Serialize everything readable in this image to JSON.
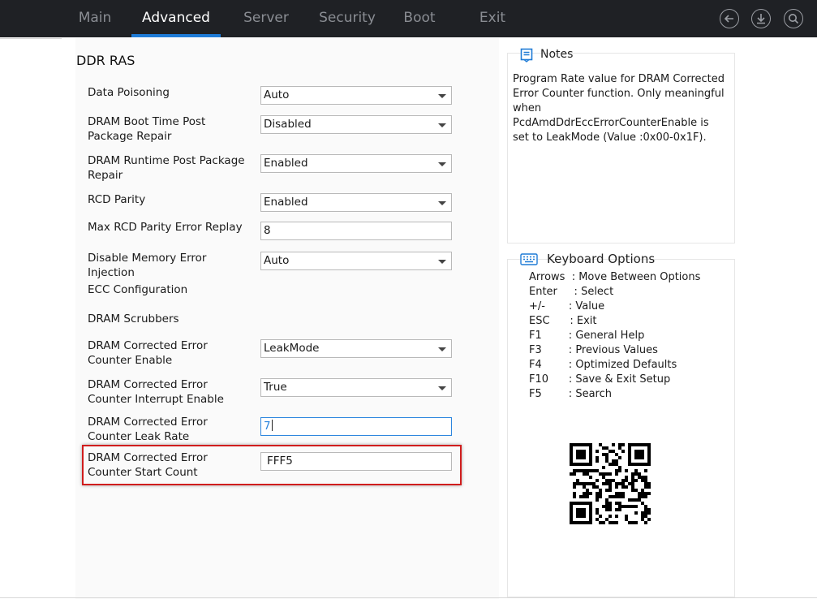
{
  "nav": {
    "tabs": [
      {
        "label": "Main"
      },
      {
        "label": "Advanced"
      },
      {
        "label": "Server"
      },
      {
        "label": "Security"
      },
      {
        "label": "Boot"
      },
      {
        "label": "Exit"
      }
    ],
    "active_tab": "Advanced",
    "icons": [
      "back-icon",
      "download-icon",
      "search-icon"
    ],
    "accent_color": "#1e7bd6"
  },
  "section": {
    "title": "DDR RAS"
  },
  "settings": [
    {
      "label": "Data Poisoning",
      "value": "Auto",
      "type": "dropdown"
    },
    {
      "label": "DRAM Boot Time Post Package Repair",
      "value": "Disabled",
      "type": "dropdown"
    },
    {
      "label": "DRAM Runtime Post Package Repair",
      "value": "Enabled",
      "type": "dropdown"
    },
    {
      "label": "RCD Parity",
      "value": "Enabled",
      "type": "dropdown"
    },
    {
      "label": "Max RCD Parity Error Replay",
      "value": "8",
      "type": "text"
    },
    {
      "label": "Disable Memory Error Injection",
      "value": "Auto",
      "type": "dropdown"
    },
    {
      "label": "ECC Configuration",
      "type": "submenu"
    },
    {
      "label": "DRAM Scrubbers",
      "type": "submenu"
    },
    {
      "label": "DRAM Corrected Error Counter Enable",
      "value": "LeakMode",
      "type": "dropdown"
    },
    {
      "label": "DRAM Corrected Error Counter Interrupt Enable",
      "value": "True",
      "type": "dropdown"
    },
    {
      "label": "DRAM Corrected Error Counter Leak Rate",
      "value": "7",
      "type": "text",
      "focused": true
    },
    {
      "label": "DRAM Corrected Error Counter Start Count",
      "value": "FFF5",
      "type": "text",
      "highlighted": true
    }
  ],
  "notes": {
    "title": "Notes",
    "text": "Program Rate value for DRAM Corrected Error Counter function. Only meaningful when PcdAmdDdrEccErrorCounterEnable is set to LeakMode (Value :0x00-0x1F)."
  },
  "keyboard": {
    "title": "Keyboard Options",
    "lines": [
      "Arrows  : Move Between Options",
      "Enter     : Select",
      "+/-       : Value",
      "ESC      : Exit",
      "F1        : General Help",
      "F3        : Previous Values",
      "F4        : Optimized Defaults",
      "F10      : Save & Exit Setup",
      "F5        : Search"
    ]
  },
  "highlight_color": "#d01d1d"
}
